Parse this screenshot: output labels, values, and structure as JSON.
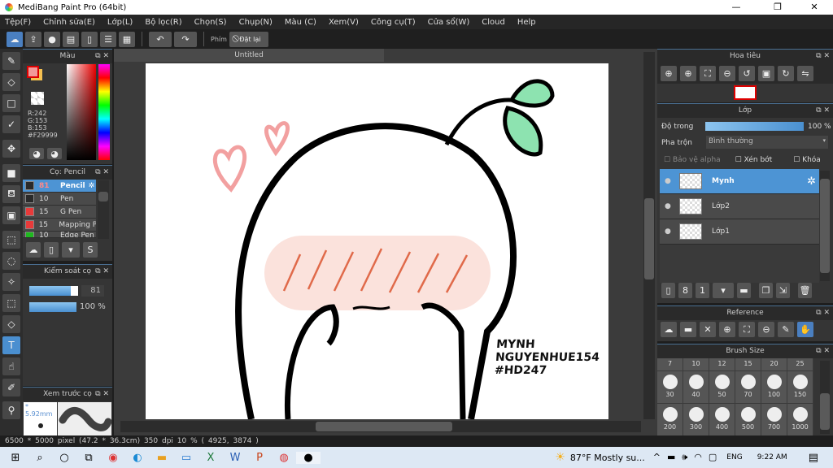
{
  "window": {
    "title": "MediBang Paint Pro (64bit)",
    "minimize": "—",
    "maximize": "❐",
    "close": "✕"
  },
  "menu": [
    "Tệp(F)",
    "Chỉnh sửa(E)",
    "Lớp(L)",
    "Bộ lọc(R)",
    "Chọn(S)",
    "Chụp(N)",
    "Màu (C)",
    "Xem(V)",
    "Công cụ(T)",
    "Cửa sổ(W)",
    "Cloud",
    "Help"
  ],
  "toolbar": {
    "shortcut_label": "Phím",
    "reset_label": "Đặt lại"
  },
  "color_panel": {
    "title": "Màu",
    "r": "R:242",
    "g": "G:153",
    "b": "B:153",
    "hex": "#F29999",
    "primary_color": "#F29999",
    "secondary_color": "#F5C050"
  },
  "brush_panel": {
    "title": "Cọ: Pencil",
    "items": [
      {
        "size": "81",
        "name": "Pencil",
        "color": "#2a2a2a",
        "selected": true
      },
      {
        "size": "10",
        "name": "Pen",
        "color": "#2a2a2a"
      },
      {
        "size": "15",
        "name": "G Pen",
        "color": "#e83a3a"
      },
      {
        "size": "15",
        "name": "Mapping P",
        "color": "#e83a3a"
      },
      {
        "size": "10",
        "name": "Edge Pen",
        "color": "#1fb81f"
      }
    ]
  },
  "brush_control": {
    "title": "Kiểm soát cọ",
    "size": "81",
    "opacity": "100 %",
    "size_fraction": 0.85,
    "opacity_fraction": 1.0
  },
  "brush_preview": {
    "title": "Xem trước cọ",
    "size": "* 5.92mm"
  },
  "document": {
    "tab": "Untitled",
    "signature": [
      "MYNH",
      "NGUYENHUE154",
      "#HD247"
    ]
  },
  "status": "6500 * 5000 pixel   (47.2 * 36.3cm)   350 dpi   10 %   ( 4925, 3874 )",
  "navigator": {
    "title": "Hoa tiêu"
  },
  "layers": {
    "title": "Lớp",
    "opacity_label": "Độ trong",
    "opacity": "100 %",
    "opacity_fraction": 1.0,
    "blend_label": "Pha trộn",
    "blend": "Bình thường",
    "protect_alpha": "Bảo vệ alpha",
    "clip": "Xén bớt",
    "lock": "Khóa",
    "items": [
      {
        "name": "Mynh",
        "selected": true
      },
      {
        "name": "Lớp2"
      },
      {
        "name": "Lớp1"
      }
    ]
  },
  "reference": {
    "title": "Reference"
  },
  "brush_size": {
    "title": "Brush Size",
    "sizes": [
      "7",
      "10",
      "12",
      "15",
      "20",
      "25",
      "30",
      "40",
      "50",
      "70",
      "100",
      "150",
      "200",
      "300",
      "400",
      "500",
      "700",
      "1000"
    ]
  },
  "taskbar": {
    "weather": "87°F  Mostly su...",
    "lang": "ENG",
    "time": "9:22 AM"
  }
}
